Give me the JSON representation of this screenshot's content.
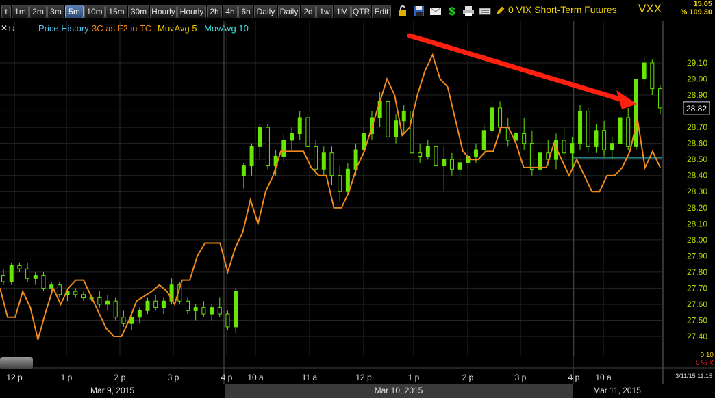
{
  "toolbar": {
    "buttons": [
      "t",
      "1m",
      "2m",
      "3m",
      "5m",
      "10m",
      "15m",
      "30m",
      "Hourly",
      "Hourly",
      "2h",
      "4h",
      "6h",
      "Daily",
      "Daily",
      "2d",
      "1w",
      "1M",
      "QTR",
      "Edit"
    ],
    "active": "5m",
    "icons": [
      "lock-icon",
      "save-icon",
      "mail-icon",
      "dollar-icon",
      "print-icon",
      "keyboard-icon"
    ]
  },
  "header": {
    "description": "0 VIX Short-Term Futures",
    "symbol": "VXX",
    "price": "15.05",
    "percent": "% 109.30",
    "last_price_marker": "28.82"
  },
  "legend": {
    "controls": "✕↑↓",
    "price_history": "Price History",
    "indicator": "3C as F2 in TC",
    "ma5": "MovAvg 5",
    "ma10": "MovAvg 10"
  },
  "footer": {
    "volume_label": "0.10",
    "lx_label": "L % X",
    "timestamp": "3/11/15 11:15",
    "dates": [
      "Mar 9, 2015",
      "Mar 10, 2015",
      "Mar 11, 2015"
    ]
  },
  "colors": {
    "up": "#66e600",
    "line": "#f08a1c",
    "arrow": "#ff2010",
    "axis_text": "#b4e000",
    "legend_price": "#5ac8f5",
    "legend_3c": "#f08a1c",
    "legend_ma5": "#f0c800",
    "legend_ma10": "#40e0e0"
  },
  "chart_data": {
    "type": "candlestick",
    "ylim": [
      27.3,
      29.3
    ],
    "yticks": [
      27.4,
      27.5,
      27.6,
      27.7,
      27.8,
      27.9,
      28.0,
      28.1,
      28.2,
      28.3,
      28.4,
      28.5,
      28.6,
      28.7,
      28.8,
      28.9,
      29.0,
      29.1
    ],
    "ytick_labels": [
      "27.40",
      "27.50",
      "27.60",
      "27.70",
      "27.80",
      "27.90",
      "28.00",
      "28.10",
      "28.20",
      "28.30",
      "28.40",
      "28.50",
      "28.60",
      "28.70",
      "28.80",
      "28.90",
      "29.00",
      "29.10"
    ],
    "xticks": [
      "12 p",
      "1 p",
      "2 p",
      "3 p",
      "4 p",
      "10 a",
      "11 a",
      "12 p",
      "1 p",
      "2 p",
      "3 p",
      "4 p",
      "10 a"
    ],
    "last_price": 28.82,
    "reference_level": 28.51,
    "x_categories": "5-minute bars, Mar 9 2015 12:00 p to Mar 11 2015 11:15",
    "bars": [
      [
        27.78,
        27.82,
        27.72,
        27.74
      ],
      [
        27.74,
        27.86,
        27.72,
        27.84
      ],
      [
        27.84,
        27.86,
        27.8,
        27.82
      ],
      [
        27.82,
        27.86,
        27.74,
        27.76
      ],
      [
        27.76,
        27.8,
        27.72,
        27.78
      ],
      [
        27.78,
        27.8,
        27.68,
        27.7
      ],
      [
        27.7,
        27.74,
        27.66,
        27.72
      ],
      [
        27.72,
        27.74,
        27.64,
        27.66
      ],
      [
        27.66,
        27.7,
        27.62,
        27.68
      ],
      [
        27.68,
        27.7,
        27.64,
        27.66
      ],
      [
        27.66,
        27.68,
        27.62,
        27.64
      ],
      [
        27.64,
        27.66,
        27.62,
        27.64
      ],
      [
        27.64,
        27.68,
        27.58,
        27.6
      ],
      [
        27.6,
        27.66,
        27.56,
        27.62
      ],
      [
        27.62,
        27.64,
        27.5,
        27.52
      ],
      [
        27.52,
        27.56,
        27.46,
        27.48
      ],
      [
        27.48,
        27.54,
        27.44,
        27.52
      ],
      [
        27.52,
        27.58,
        27.48,
        27.56
      ],
      [
        27.56,
        27.64,
        27.54,
        27.62
      ],
      [
        27.62,
        27.66,
        27.56,
        27.58
      ],
      [
        27.58,
        27.64,
        27.54,
        27.62
      ],
      [
        27.62,
        27.76,
        27.6,
        27.72
      ],
      [
        27.72,
        27.74,
        27.6,
        27.62
      ],
      [
        27.62,
        27.64,
        27.54,
        27.56
      ],
      [
        27.56,
        27.6,
        27.5,
        27.58
      ],
      [
        27.58,
        27.62,
        27.52,
        27.54
      ],
      [
        27.54,
        27.6,
        27.5,
        27.58
      ],
      [
        27.58,
        27.64,
        27.52,
        27.54
      ],
      [
        27.54,
        27.56,
        27.44,
        27.46
      ],
      [
        27.46,
        27.7,
        27.42,
        27.68
      ],
      [
        28.4,
        28.48,
        28.32,
        28.46
      ],
      [
        28.46,
        28.6,
        28.4,
        28.58
      ],
      [
        28.58,
        28.72,
        28.5,
        28.7
      ],
      [
        28.7,
        28.72,
        28.44,
        28.46
      ],
      [
        28.46,
        28.56,
        28.4,
        28.52
      ],
      [
        28.52,
        28.66,
        28.48,
        28.62
      ],
      [
        28.62,
        28.7,
        28.56,
        28.66
      ],
      [
        28.66,
        28.8,
        28.62,
        28.76
      ],
      [
        28.76,
        28.78,
        28.56,
        28.58
      ],
      [
        28.58,
        28.62,
        28.4,
        28.44
      ],
      [
        28.44,
        28.58,
        28.4,
        28.54
      ],
      [
        28.54,
        28.58,
        28.34,
        28.4
      ],
      [
        28.4,
        28.46,
        28.24,
        28.3
      ],
      [
        28.3,
        28.48,
        28.28,
        28.44
      ],
      [
        28.44,
        28.6,
        28.4,
        28.56
      ],
      [
        28.56,
        28.7,
        28.52,
        28.66
      ],
      [
        28.66,
        28.8,
        28.62,
        28.76
      ],
      [
        28.76,
        28.92,
        28.7,
        28.86
      ],
      [
        28.86,
        28.88,
        28.62,
        28.64
      ],
      [
        28.64,
        28.78,
        28.6,
        28.74
      ],
      [
        28.74,
        28.84,
        28.66,
        28.8
      ],
      [
        28.8,
        28.82,
        28.5,
        28.54
      ],
      [
        28.54,
        28.6,
        28.48,
        28.52
      ],
      [
        28.52,
        28.62,
        28.5,
        28.58
      ],
      [
        28.58,
        28.6,
        28.44,
        28.46
      ],
      [
        28.46,
        28.58,
        28.3,
        28.5
      ],
      [
        28.5,
        28.54,
        28.4,
        28.44
      ],
      [
        28.44,
        28.52,
        28.38,
        28.48
      ],
      [
        28.48,
        28.56,
        28.44,
        28.52
      ],
      [
        28.52,
        28.6,
        28.48,
        28.56
      ],
      [
        28.56,
        28.72,
        28.52,
        28.68
      ],
      [
        28.68,
        28.86,
        28.64,
        28.82
      ],
      [
        28.82,
        28.86,
        28.66,
        28.7
      ],
      [
        28.7,
        28.76,
        28.58,
        28.62
      ],
      [
        28.62,
        28.7,
        28.54,
        28.66
      ],
      [
        28.66,
        28.76,
        28.56,
        28.6
      ],
      [
        28.6,
        28.68,
        28.4,
        28.44
      ],
      [
        28.44,
        28.58,
        28.4,
        28.54
      ],
      [
        28.54,
        28.62,
        28.46,
        28.5
      ],
      [
        28.5,
        28.66,
        28.44,
        28.62
      ],
      [
        28.62,
        28.7,
        28.5,
        28.54
      ],
      [
        28.54,
        28.64,
        28.44,
        28.6
      ],
      [
        28.6,
        28.84,
        28.56,
        28.8
      ],
      [
        28.8,
        28.82,
        28.54,
        28.58
      ],
      [
        28.58,
        28.72,
        28.54,
        28.68
      ],
      [
        28.68,
        28.74,
        28.52,
        28.56
      ],
      [
        28.56,
        28.64,
        28.5,
        28.6
      ],
      [
        28.6,
        28.8,
        28.58,
        28.76
      ],
      [
        28.76,
        28.82,
        28.56,
        28.58
      ],
      [
        28.58,
        28.84,
        28.56,
        29.0
      ],
      [
        29.0,
        29.14,
        28.96,
        29.1
      ],
      [
        29.1,
        29.12,
        28.9,
        28.94
      ],
      [
        28.94,
        28.96,
        28.78,
        28.82
      ]
    ],
    "series": [
      {
        "name": "3C as F2 in TC",
        "values": [
          27.7,
          27.52,
          27.52,
          27.68,
          27.58,
          27.38,
          27.55,
          27.7,
          27.6,
          27.7,
          27.75,
          27.75,
          27.65,
          27.55,
          27.45,
          27.4,
          27.4,
          27.5,
          27.62,
          27.65,
          27.68,
          27.72,
          27.68,
          27.6,
          27.75,
          27.75,
          27.9,
          27.98,
          27.98,
          27.98,
          27.8,
          27.95,
          28.05,
          28.25,
          28.1,
          28.3,
          28.4,
          28.55,
          28.55,
          28.55,
          28.55,
          28.45,
          28.4,
          28.4,
          28.2,
          28.2,
          28.3,
          28.45,
          28.55,
          28.7,
          28.85,
          29.0,
          28.9,
          28.65,
          28.7,
          28.9,
          29.05,
          29.15,
          29.0,
          28.95,
          28.75,
          28.55,
          28.5,
          28.5,
          28.55,
          28.55,
          28.7,
          28.7,
          28.6,
          28.45,
          28.45,
          28.45,
          28.45,
          28.6,
          28.5,
          28.4,
          28.5,
          28.4,
          28.3,
          28.3,
          28.4,
          28.4,
          28.45,
          28.55,
          28.75,
          28.45,
          28.55,
          28.45
        ]
      }
    ],
    "annotation": "red downward-sloping arrow from the 3C line high near 1 p Mar 10 to the 3C line high near 10:30 a Mar 11"
  }
}
